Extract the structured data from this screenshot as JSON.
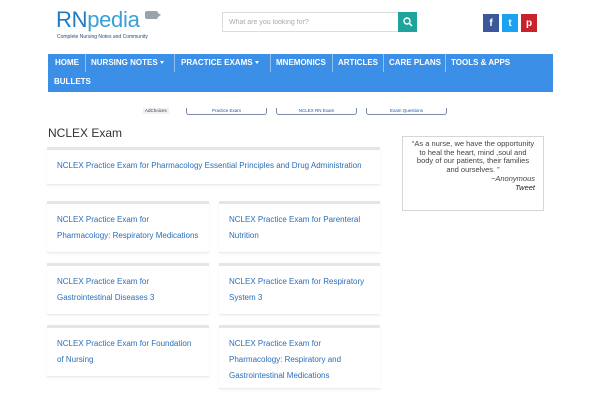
{
  "logo": {
    "rn": "RN",
    "pedia": "pedia",
    "tagline": "Complete Nursing Notes and Community"
  },
  "search": {
    "placeholder": "What are you looking for?"
  },
  "social": {
    "facebook": "f",
    "twitter": "t",
    "pinterest": "p"
  },
  "colors": {
    "nav": "#3b8fe6",
    "link": "#2a6fb8",
    "search_button": "#1fa39b"
  },
  "nav": {
    "items": [
      {
        "label": "HOME"
      },
      {
        "label": "NURSING NOTES"
      },
      {
        "label": "PRACTICE EXAMS"
      },
      {
        "label": "MNEMONICS"
      },
      {
        "label": "ARTICLES"
      },
      {
        "label": "CARE PLANS"
      },
      {
        "label": "TOOLS & APPS"
      },
      {
        "label": "BULLETS"
      }
    ]
  },
  "ads": {
    "adchoices": "AdChoices",
    "links": [
      "Practice Exam",
      "NCLEX RN Exam",
      "Exam Questions"
    ]
  },
  "page": {
    "title": "NCLEX Exam"
  },
  "cards": [
    {
      "title": "NCLEX Practice Exam for Pharmacology Essential Principles and Drug Administration"
    },
    {
      "title": "NCLEX Practice Exam for Pharmacology: Respiratory Medications"
    },
    {
      "title": "NCLEX Practice Exam for Parenteral Nutrition"
    },
    {
      "title": "NCLEX Practice Exam for Gastrointestinal Diseases 3"
    },
    {
      "title": "NCLEX Practice Exam for Respiratory System 3"
    },
    {
      "title": "NCLEX Practice Exam for Foundation of Nursing"
    },
    {
      "title": "NCLEX Practice Exam for Pharmacology: Respiratory and Gastrointestinal Medications"
    }
  ],
  "quote": {
    "text": "“As a nurse, we have the opportunity to heal the heart, mind ,soul and body of our patients, their families and ourselves. ”",
    "author": "~Anonymous",
    "tweet": "Tweet"
  }
}
